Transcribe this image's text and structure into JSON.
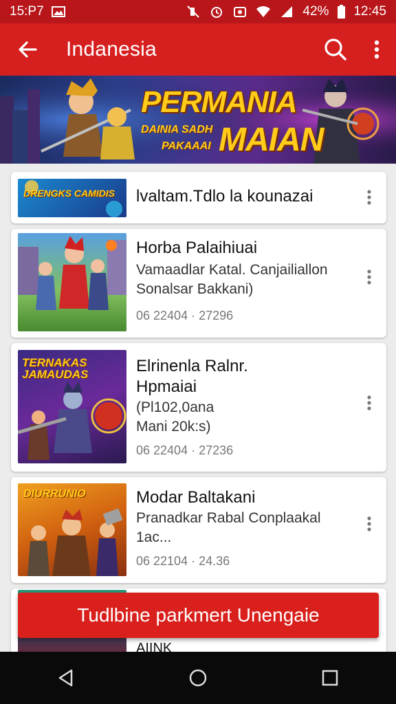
{
  "status_bar": {
    "time_left": "15:P7",
    "battery": "42%",
    "time_right": "12:45",
    "icons_left": [
      "image-icon"
    ],
    "icons_right": [
      "mute-icon",
      "alarm-icon",
      "screenshot-icon",
      "wifi-icon",
      "signal-icon",
      "battery-icon"
    ]
  },
  "app_bar": {
    "title": "Indanesia"
  },
  "banner": {
    "title": "PERMANIA",
    "line1": "DAINIA SADH",
    "line2": "PAKAAAI",
    "word": "MAIAN"
  },
  "items": [
    {
      "thumb_text": "DRENGKS CAMIDIS",
      "title": "lvaltam.Tdlo la kounazai"
    },
    {
      "thumb_text": "",
      "title": "Horba Palaihiuai",
      "desc1": "Vamaadlar Katal. Canjailiallon",
      "desc2": "Sonalsar Bakkani)",
      "meta": "06 22404 · 27296"
    },
    {
      "thumb_text": "TERNAKAS JAMAUDAS",
      "title": "Elrinenla Ralnr.",
      "title2": "Hpmaiai",
      "desc1": "(Pl102,0ana",
      "desc2": "Mani 20k:s)",
      "meta": "06 22404 · 27236"
    },
    {
      "thumb_text": "DIURRUNIO",
      "title": "Modar Baltakani",
      "desc1": "Pranadkar Rabal Conplaakal",
      "desc2": "1ac...",
      "meta": "06 22104 · 24.36"
    }
  ],
  "partial_item": {
    "title": "AIINK"
  },
  "cta": {
    "label": "Tudlbine parkmert Unengaie"
  },
  "colors": {
    "status_bar": "#b8161a",
    "app_bar": "#d61f1f",
    "cta": "#d9201c"
  }
}
